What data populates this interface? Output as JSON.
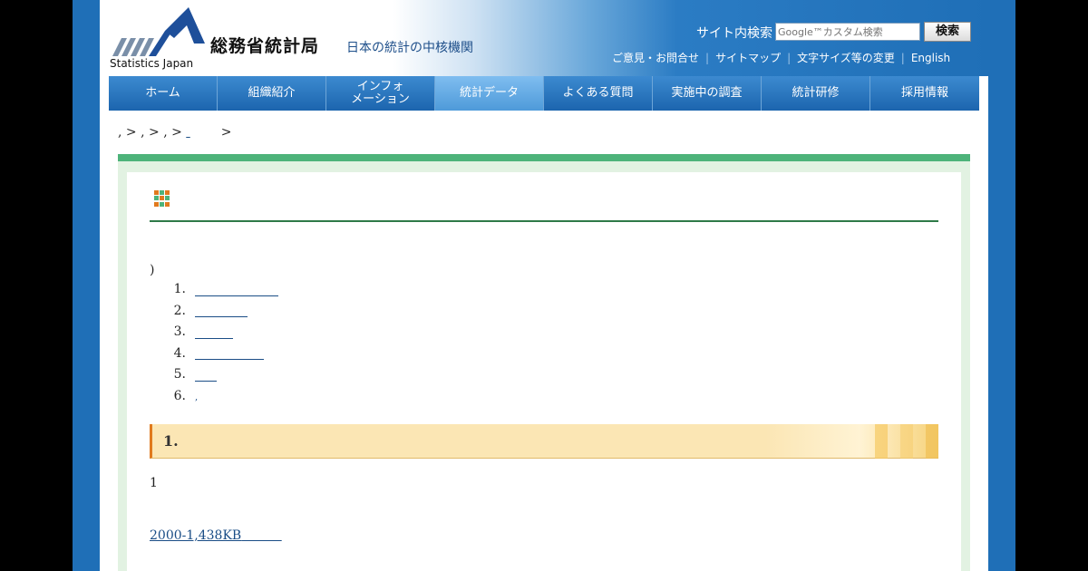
{
  "header": {
    "logo_en": "Statistics Japan",
    "logo_jp": "総務省統計局",
    "tagline": "日本の統計の中核機関",
    "search_label": "サイト内検索",
    "search_placeholder": "Google™カスタム検索",
    "search_button": "検索",
    "utility_links": [
      "ご意見・お問合せ",
      "サイトマップ",
      "文字サイズ等の変更",
      "English"
    ]
  },
  "nav": {
    "items": [
      {
        "label": "ホーム"
      },
      {
        "label": "組織紹介"
      },
      {
        "label": "インフォ\nメーション"
      },
      {
        "label": "統計データ"
      },
      {
        "label": "よくある質問"
      },
      {
        "label": "実施中の調査"
      },
      {
        "label": "統計研修"
      },
      {
        "label": "採用情報"
      }
    ],
    "active": "統計データ"
  },
  "breadcrumb": {
    "text_1": ",",
    "sep_1": ">",
    "text_2": ",",
    "sep_2": ">",
    "text_3": ",",
    "sep_3": ">",
    "sep_4": ">"
  },
  "content": {
    "paren": ")",
    "toc": [
      {
        "num": "1."
      },
      {
        "num": "2."
      },
      {
        "num": "3."
      },
      {
        "num": "4."
      },
      {
        "num": "5."
      },
      {
        "num": "6.",
        "text": ","
      }
    ],
    "section1_title": "1.",
    "section1_text": "1",
    "download_link": "2000-1,438KB"
  },
  "colors": {
    "brand_blue": "#1f6fb7",
    "nav_active": "#5da5e0",
    "frame_green": "#4db37a",
    "section_accent": "#e07a1e"
  }
}
